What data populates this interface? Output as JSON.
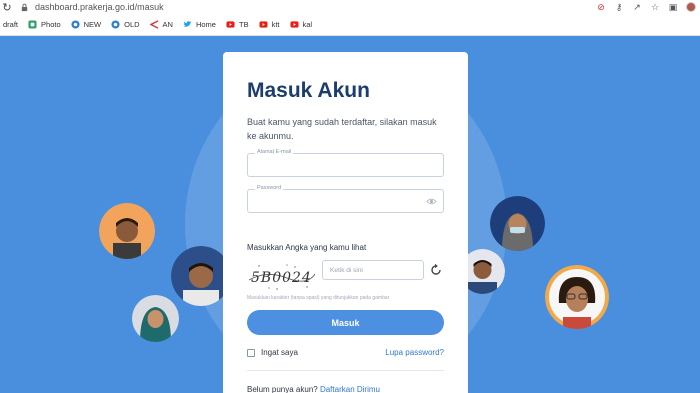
{
  "browser": {
    "url": "dashboard.prakerja.go.id/masuk",
    "bookmarks": [
      {
        "label": "draft",
        "icon": "none",
        "color": ""
      },
      {
        "label": "Photo",
        "icon": "photo-icon",
        "color": "#2e9f6b"
      },
      {
        "label": "NEW",
        "icon": "globe-icon",
        "color": "#2a7dd1"
      },
      {
        "label": "OLD",
        "icon": "globe-icon",
        "color": "#2a7dd1"
      },
      {
        "label": "AN",
        "icon": "arrow-icon",
        "color": "#d13a3a"
      },
      {
        "label": "Home",
        "icon": "twitter-icon",
        "color": "#1da1f2"
      },
      {
        "label": "TB",
        "icon": "youtube-icon",
        "color": "#e62117"
      },
      {
        "label": "ktt",
        "icon": "youtube-icon",
        "color": "#e62117"
      },
      {
        "label": "kal",
        "icon": "youtube-icon",
        "color": "#e62117"
      }
    ]
  },
  "login": {
    "title": "Masuk Akun",
    "subtitle": "Buat kamu yang sudah terdaftar, silakan masuk ke akunmu.",
    "email_label": "Alamat E-mail",
    "password_label": "Password",
    "captcha_label": "Masukkan Angka yang kamu lihat",
    "captcha_text": "5B0024",
    "captcha_placeholder": "Ketik di sini",
    "captcha_hint": "Masukkan karakter (tanpa spasi) yang ditunjukkan pada gambar",
    "submit_label": "Masuk",
    "remember_label": "Ingat saya",
    "forgot_label": "Lupa password?",
    "register_prompt": "Belum punya akun?",
    "register_link": "Daftarkan Dirimu"
  },
  "colors": {
    "page_bg": "#4a8fde",
    "primary": "#4d8fe0",
    "title": "#1c3d6e",
    "link": "#2f78d0"
  }
}
